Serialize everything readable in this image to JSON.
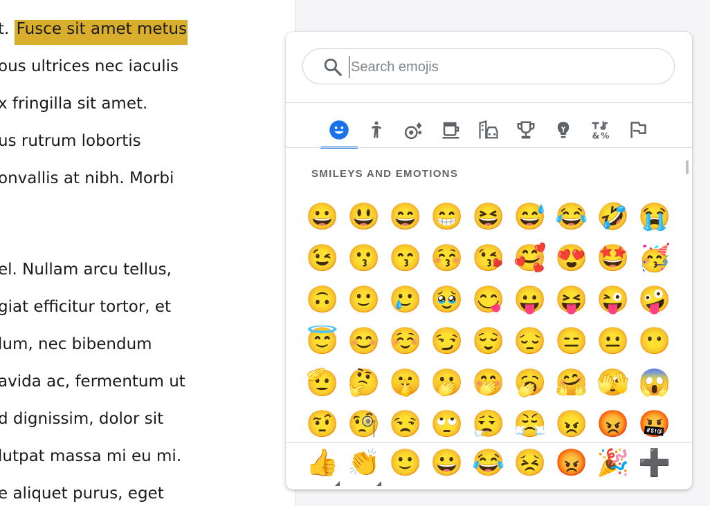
{
  "document": {
    "lines": [
      {
        "prefix": "t. ",
        "highlight": "Fusce sit amet metus",
        "text": ""
      },
      {
        "text": "ous ultrices nec iaculis"
      },
      {
        "text": "x fringilla sit amet."
      },
      {
        "text": "us rutrum lobortis"
      },
      {
        "text": "onvallis at nibh. Morbi"
      },
      {
        "text": "el. Nullam arcu tellus,"
      },
      {
        "text": "giat efficitur tortor, et"
      },
      {
        "text": "lum, nec bibendum"
      },
      {
        "text": "avida ac, fermentum ut"
      },
      {
        "text": "d dignissim, dolor sit"
      },
      {
        "text": "lutpat massa mi eu mi."
      },
      {
        "text": "e aliquet purus, eget"
      }
    ],
    "highlight_color": "#d9ae2c"
  },
  "picker": {
    "search_placeholder": "Search emojis",
    "search_value": "",
    "accent_color": "#1a73e8",
    "tabs": [
      {
        "icon": "smiley-icon",
        "active": true
      },
      {
        "icon": "person-icon",
        "active": false
      },
      {
        "icon": "nature-icon",
        "active": false
      },
      {
        "icon": "food-drink-icon",
        "active": false
      },
      {
        "icon": "travel-places-icon",
        "active": false
      },
      {
        "icon": "trophy-activities-icon",
        "active": false
      },
      {
        "icon": "lightbulb-objects-icon",
        "active": false
      },
      {
        "icon": "symbols-icon",
        "active": false
      },
      {
        "icon": "flag-icon",
        "active": false
      }
    ],
    "section_title": "SMILEYS AND EMOTIONS",
    "emoji_rows": [
      [
        "😀",
        "😃",
        "😄",
        "😁",
        "😆",
        "😅",
        "😂",
        "🤣",
        "😭"
      ],
      [
        "😉",
        "😗",
        "😙",
        "😚",
        "😘",
        "🥰",
        "😍",
        "🤩",
        "🥳"
      ],
      [
        "🙃",
        "🙂",
        "🥲",
        "🥹",
        "😋",
        "😛",
        "😝",
        "😜",
        "🤪"
      ],
      [
        "😇",
        "😊",
        "☺️",
        "😏",
        "😌",
        "😔",
        "😑",
        "😐",
        "😶"
      ],
      [
        "🫡",
        "🤔",
        "🤫",
        "🫢",
        "🤭",
        "🥱",
        "🤗",
        "🫣",
        "😱"
      ],
      [
        "🤨",
        "🧐",
        "😒",
        "🙄",
        "😮‍💨",
        "😤",
        "😠",
        "😡",
        "🤬"
      ]
    ],
    "recent": [
      "👍",
      "👏",
      "🙂",
      "😀",
      "😂",
      "😣",
      "😡",
      "🎉",
      "➕"
    ],
    "recent_has_variants": [
      true,
      true,
      false,
      false,
      false,
      false,
      false,
      false,
      false
    ]
  }
}
